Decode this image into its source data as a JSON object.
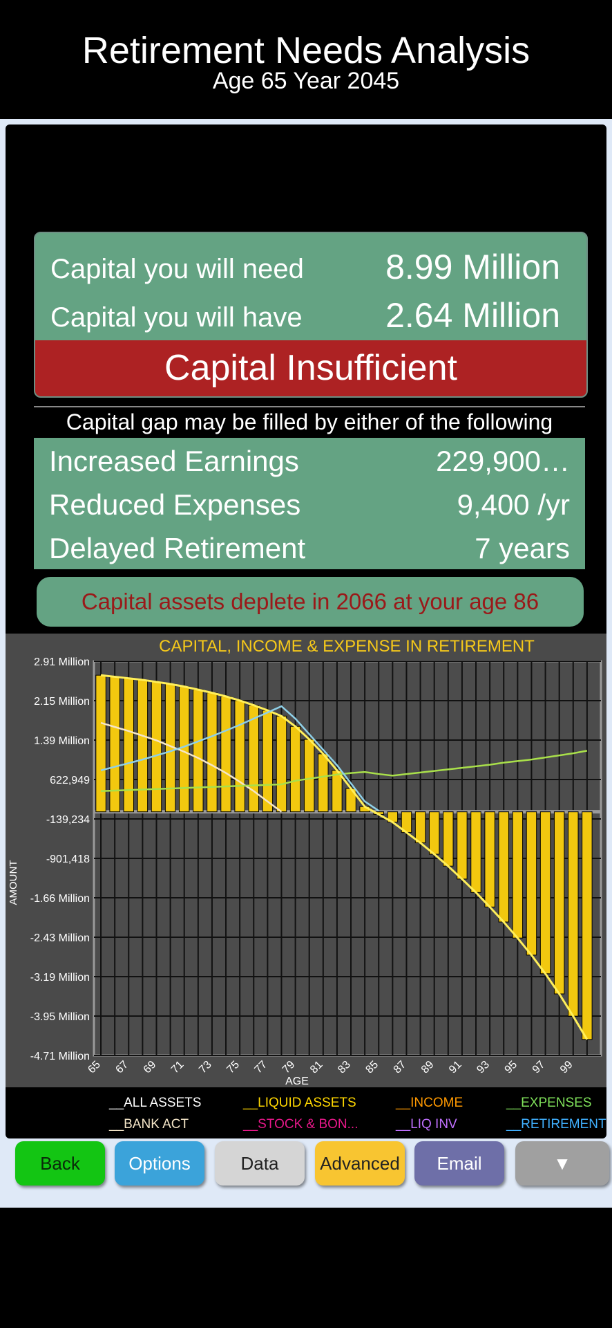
{
  "header": {
    "title": "Retirement Needs Analysis",
    "subtitle": "Age 65 Year 2045"
  },
  "capital": {
    "need_label": "Capital you will need",
    "need_value": "8.99 Million",
    "have_label": "Capital you will have",
    "have_value": "2.64 Million",
    "status": "Capital Insufficient"
  },
  "gap": {
    "intro": "Capital gap may be filled by either of the following",
    "rows": [
      {
        "label": "Increased Earnings",
        "value": "229,900…"
      },
      {
        "label": "Reduced Expenses",
        "value": "9,400 /yr"
      },
      {
        "label": "Delayed Retirement",
        "value": "7 years"
      }
    ]
  },
  "deplete_msg": "Capital assets deplete in 2066 at your age 86",
  "chart_data": {
    "type": "bar",
    "title": "CAPITAL, INCOME & EXPENSE IN RETIREMENT",
    "xlabel": "AGE",
    "ylabel": "AMOUNT",
    "ytick_labels": [
      "2.91 Million",
      "2.15 Million",
      "1.39 Million",
      "622,949",
      "-139,234",
      "-901,418",
      "-1.66 Million",
      "-2.43 Million",
      "-3.19 Million",
      "-3.95 Million",
      "-4.71 Million"
    ],
    "ylim": [
      -4.71,
      2.91
    ],
    "yunit": "Million",
    "xtick_labels": [
      "65",
      "67",
      "69",
      "71",
      "73",
      "75",
      "77",
      "79",
      "81",
      "83",
      "85",
      "87",
      "89",
      "91",
      "93",
      "95",
      "97",
      "99"
    ],
    "x": [
      65,
      66,
      67,
      68,
      69,
      70,
      71,
      72,
      73,
      74,
      75,
      76,
      77,
      78,
      79,
      80,
      81,
      82,
      83,
      84,
      85,
      86,
      87,
      88,
      89,
      90,
      91,
      92,
      93,
      94,
      95,
      96,
      97,
      98,
      99,
      100
    ],
    "series": [
      {
        "name": "ALL ASSETS",
        "color": "#ffd700",
        "values": [
          2.64,
          2.61,
          2.58,
          2.55,
          2.51,
          2.47,
          2.42,
          2.36,
          2.3,
          2.23,
          2.15,
          2.06,
          1.96,
          1.85,
          1.65,
          1.4,
          1.12,
          0.8,
          0.45,
          0.1,
          -0.05,
          -0.2,
          -0.4,
          -0.6,
          -0.82,
          -1.05,
          -1.3,
          -1.56,
          -1.84,
          -2.13,
          -2.44,
          -2.77,
          -3.13,
          -3.52,
          -3.95,
          -4.4
        ]
      },
      {
        "name": "INCOME",
        "color": "#f5e6c8",
        "values": [
          1.72,
          1.64,
          1.56,
          1.47,
          1.38,
          1.27,
          1.16,
          1.04,
          0.9,
          0.75,
          0.58,
          0.4,
          0.2,
          0.0,
          null,
          null,
          null,
          null,
          null,
          null,
          null,
          null,
          null,
          null,
          null,
          null,
          null,
          null,
          null,
          null,
          null,
          null,
          null,
          null,
          null,
          null
        ]
      },
      {
        "name": "EXPENSES",
        "color": "#a9e04a",
        "values": [
          0.4,
          0.41,
          0.42,
          0.43,
          0.44,
          0.45,
          0.46,
          0.47,
          0.48,
          0.49,
          0.5,
          0.51,
          0.52,
          0.53,
          0.6,
          0.64,
          0.68,
          0.72,
          0.75,
          0.77,
          0.73,
          0.7,
          0.73,
          0.76,
          0.79,
          0.82,
          0.85,
          0.88,
          0.91,
          0.95,
          0.98,
          1.01,
          1.05,
          1.09,
          1.13,
          1.18
        ]
      },
      {
        "name": "RETIREMENT",
        "color": "#8fd0e8",
        "values": [
          0.8,
          0.87,
          0.94,
          1.01,
          1.09,
          1.17,
          1.26,
          1.36,
          1.46,
          1.57,
          1.68,
          1.8,
          1.92,
          2.04,
          1.8,
          1.5,
          1.2,
          0.9,
          0.55,
          0.2,
          0.02,
          null,
          null,
          null,
          null,
          null,
          null,
          null,
          null,
          null,
          null,
          null,
          null,
          null,
          null,
          null
        ]
      }
    ]
  },
  "legend": [
    {
      "label": "__ALL ASSETS",
      "color": "#ffffff"
    },
    {
      "label": "__LIQUID ASSETS",
      "color": "#ffd700"
    },
    {
      "label": "__INCOME",
      "color": "#ff9900"
    },
    {
      "label": "__EXPENSES",
      "color": "#7fe05a"
    },
    {
      "label": "__BANK ACT",
      "color": "#f5e6c8"
    },
    {
      "label": "__STOCK & BON...",
      "color": "#e8188a"
    },
    {
      "label": "__LIQ INV",
      "color": "#c070ff"
    },
    {
      "label": "__RETIREMENT",
      "color": "#40b0ff"
    }
  ],
  "buttons": {
    "back": "Back",
    "options": "Options",
    "data": "Data",
    "advanced": "Advanced",
    "email": "Email",
    "more": "▼"
  }
}
